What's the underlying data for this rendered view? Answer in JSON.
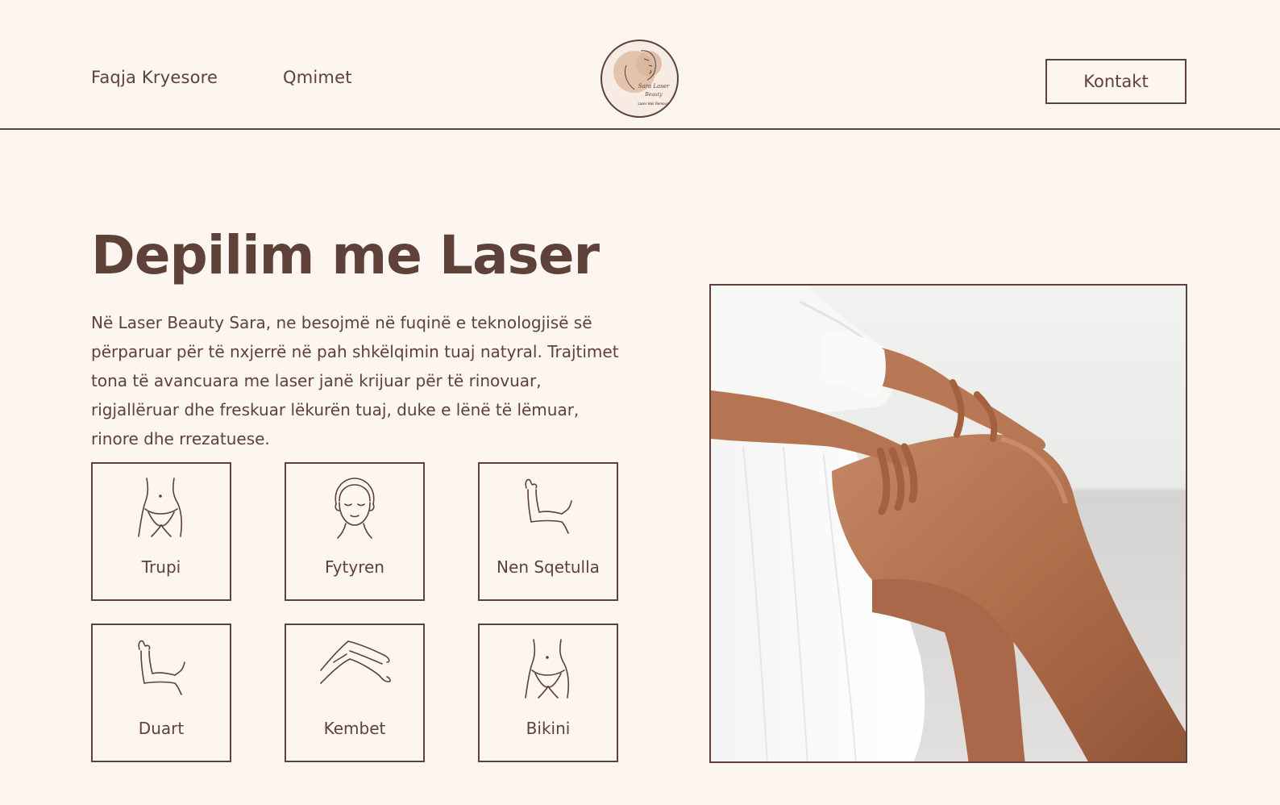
{
  "nav": {
    "home_label": "Faqja Kryesore",
    "prices_label": "Qmimet",
    "contact_label": "Kontakt"
  },
  "logo": {
    "line1": "Sara Laser",
    "line2": "Beauty",
    "tagline": "Laser Hair Removal"
  },
  "hero": {
    "title": "Depilim me Laser",
    "description": "Në Laser Beauty Sara, ne besojmë në fuqinë e teknologjisë së përparuar për të nxjerrë në pah shkëlqimin tuaj natyral. Trajtimet tona të avancuara me laser janë krijuar për të rinovuar, rigjallëruar dhe freskuar lëkurën tuaj, duke e lënë të lëmuar, rinore dhe rrezatuese."
  },
  "treatments": [
    {
      "label": "Trupi",
      "icon": "body-icon"
    },
    {
      "label": "Fytyren",
      "icon": "face-icon"
    },
    {
      "label": "Nen Sqetulla",
      "icon": "underarm-icon"
    },
    {
      "label": "Duart",
      "icon": "arm-icon"
    },
    {
      "label": "Kembet",
      "icon": "legs-icon"
    },
    {
      "label": "Bikini",
      "icon": "bikini-icon"
    }
  ],
  "colors": {
    "background": "#fdf6f0",
    "primary": "#5e4138",
    "skin": "#b57553"
  }
}
